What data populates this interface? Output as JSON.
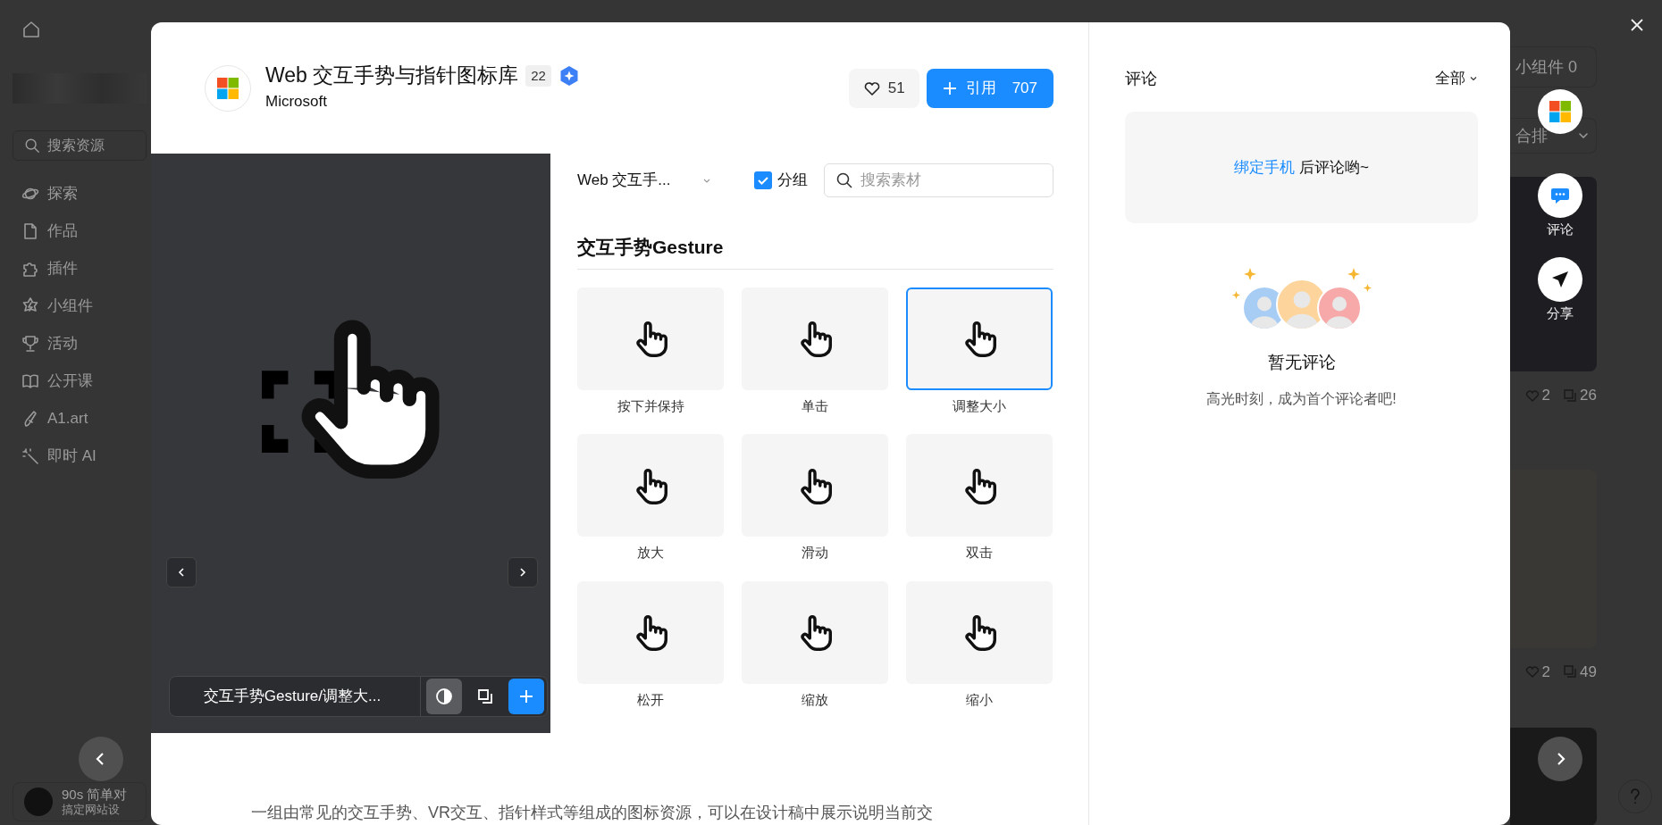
{
  "app": {
    "search_placeholder": "搜索资源",
    "nav": [
      {
        "kind": "explore",
        "label": "探索"
      },
      {
        "kind": "file",
        "label": "作品"
      },
      {
        "kind": "plugin",
        "label": "插件"
      },
      {
        "kind": "widget",
        "label": "小组件"
      },
      {
        "kind": "event",
        "label": "活动"
      },
      {
        "kind": "course",
        "label": "公开课"
      },
      {
        "kind": "art",
        "label": "A1.art"
      },
      {
        "kind": "ai",
        "label": "即时 AI"
      }
    ],
    "promo": {
      "title": "90s 简单对",
      "subtitle": "搞定网站设"
    },
    "widget_filter": "小组件 0",
    "sort": "合排",
    "cards": [
      {
        "likes": "2",
        "copies": "26"
      },
      {
        "likes": "2",
        "copies": "49"
      }
    ]
  },
  "modal": {
    "title": "Web 交互手势与指针图标库",
    "count": "22",
    "author": "Microsoft",
    "likes": "51",
    "cite": {
      "label": "引用",
      "count": "707"
    },
    "preview": {
      "caption": "交互手势Gesture/调整大...",
      "contrast_on": true
    },
    "library_select": "Web 交互手...",
    "group": {
      "label": "分组",
      "checked": true
    },
    "search_placeholder": "搜索素材",
    "section": "交互手势Gesture",
    "tiles": [
      {
        "label": "按下并保持",
        "selected": false
      },
      {
        "label": "单击",
        "selected": false
      },
      {
        "label": "调整大小",
        "selected": true
      },
      {
        "label": "放大",
        "selected": false
      },
      {
        "label": "滑动",
        "selected": false
      },
      {
        "label": "双击",
        "selected": false
      },
      {
        "label": "松开",
        "selected": false
      },
      {
        "label": "缩放",
        "selected": false
      },
      {
        "label": "缩小",
        "selected": false
      }
    ],
    "description": "一组由常见的交互手势、VR交互、指针样式等组成的图标资源，可以在设计稿中展示说明当前交"
  },
  "comments": {
    "title": "评论",
    "filter": "全部",
    "prompt": {
      "link": "绑定手机",
      "text": "后评论哟~"
    },
    "empty_title": "暂无评论",
    "empty_text": "高光时刻，成为首个评论者吧!"
  },
  "side_actions": [
    {
      "kind": "author"
    },
    {
      "kind": "comment",
      "label": "评论"
    },
    {
      "kind": "share",
      "label": "分享"
    }
  ]
}
